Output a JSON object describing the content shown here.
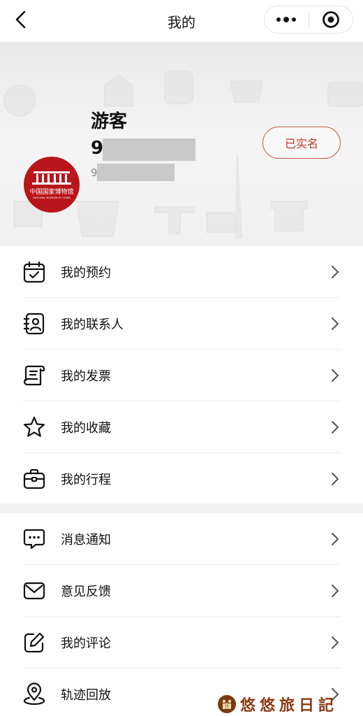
{
  "header": {
    "title": "我的"
  },
  "profile": {
    "name": "游客",
    "phone_prefix": "9",
    "id_prefix": "9",
    "verified_label": "已实名",
    "avatar_title": "中国国家博物馆",
    "avatar_subtitle": "NATIONAL MUSEUM OF CHINA"
  },
  "menu_group1": [
    {
      "label": "我的预约",
      "icon": "calendar-check-icon"
    },
    {
      "label": "我的联系人",
      "icon": "contact-book-icon"
    },
    {
      "label": "我的发票",
      "icon": "invoice-icon"
    },
    {
      "label": "我的收藏",
      "icon": "star-icon"
    },
    {
      "label": "我的行程",
      "icon": "briefcase-icon"
    }
  ],
  "menu_group2": [
    {
      "label": "消息通知",
      "icon": "message-icon"
    },
    {
      "label": "意见反馈",
      "icon": "envelope-icon"
    },
    {
      "label": "我的评论",
      "icon": "edit-icon"
    },
    {
      "label": "轨迹回放",
      "icon": "location-pin-icon"
    }
  ],
  "watermark": {
    "text": "悠悠旅日記"
  },
  "colors": {
    "accent": "#c0392b",
    "avatar_bg": "#b8161b",
    "watermark": "#8b3a14"
  }
}
